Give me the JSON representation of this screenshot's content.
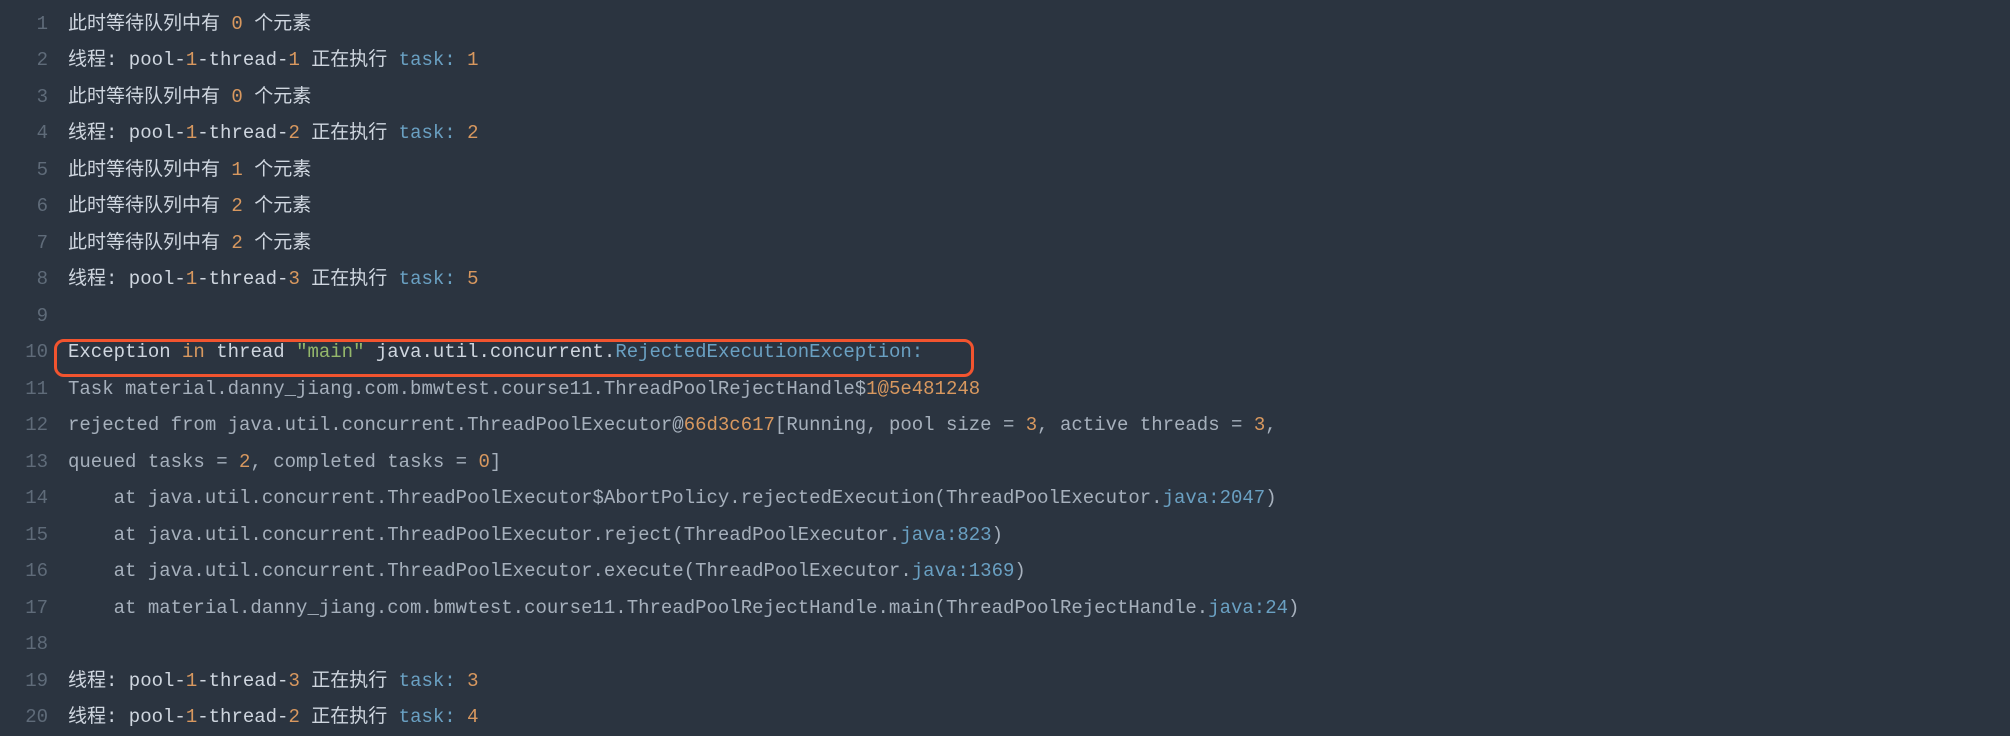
{
  "lines": [
    {
      "n": "1",
      "segs": [
        {
          "t": "此时等待队列中有 ",
          "c": "tok-cn"
        },
        {
          "t": "0",
          "c": "tok-num"
        },
        {
          "t": " 个元素",
          "c": "tok-cn"
        }
      ]
    },
    {
      "n": "2",
      "segs": [
        {
          "t": "线程: pool-",
          "c": "tok-cn"
        },
        {
          "t": "1",
          "c": "tok-num"
        },
        {
          "t": "-thread-",
          "c": "tok-cn"
        },
        {
          "t": "1",
          "c": "tok-num"
        },
        {
          "t": " 正在执行 ",
          "c": "tok-cn"
        },
        {
          "t": "task: ",
          "c": "tok-id"
        },
        {
          "t": "1",
          "c": "tok-num"
        }
      ]
    },
    {
      "n": "3",
      "segs": [
        {
          "t": "此时等待队列中有 ",
          "c": "tok-cn"
        },
        {
          "t": "0",
          "c": "tok-num"
        },
        {
          "t": " 个元素",
          "c": "tok-cn"
        }
      ]
    },
    {
      "n": "4",
      "segs": [
        {
          "t": "线程: pool-",
          "c": "tok-cn"
        },
        {
          "t": "1",
          "c": "tok-num"
        },
        {
          "t": "-thread-",
          "c": "tok-cn"
        },
        {
          "t": "2",
          "c": "tok-num"
        },
        {
          "t": " 正在执行 ",
          "c": "tok-cn"
        },
        {
          "t": "task: ",
          "c": "tok-id"
        },
        {
          "t": "2",
          "c": "tok-num"
        }
      ]
    },
    {
      "n": "5",
      "segs": [
        {
          "t": "此时等待队列中有 ",
          "c": "tok-cn"
        },
        {
          "t": "1",
          "c": "tok-num"
        },
        {
          "t": " 个元素",
          "c": "tok-cn"
        }
      ]
    },
    {
      "n": "6",
      "segs": [
        {
          "t": "此时等待队列中有 ",
          "c": "tok-cn"
        },
        {
          "t": "2",
          "c": "tok-num"
        },
        {
          "t": " 个元素",
          "c": "tok-cn"
        }
      ]
    },
    {
      "n": "7",
      "segs": [
        {
          "t": "此时等待队列中有 ",
          "c": "tok-cn"
        },
        {
          "t": "2",
          "c": "tok-num"
        },
        {
          "t": " 个元素",
          "c": "tok-cn"
        }
      ]
    },
    {
      "n": "8",
      "segs": [
        {
          "t": "线程: pool-",
          "c": "tok-cn"
        },
        {
          "t": "1",
          "c": "tok-num"
        },
        {
          "t": "-thread-",
          "c": "tok-cn"
        },
        {
          "t": "3",
          "c": "tok-num"
        },
        {
          "t": " 正在执行 ",
          "c": "tok-cn"
        },
        {
          "t": "task: ",
          "c": "tok-id"
        },
        {
          "t": "5",
          "c": "tok-num"
        }
      ]
    },
    {
      "n": "9",
      "segs": []
    },
    {
      "n": "10",
      "highlight": true,
      "hl_width": 920,
      "segs": [
        {
          "t": "Exception ",
          "c": "tok-default"
        },
        {
          "t": "in",
          "c": "tok-kw"
        },
        {
          "t": " thread ",
          "c": "tok-default"
        },
        {
          "t": "\"main\"",
          "c": "tok-str"
        },
        {
          "t": " java.util.concurrent.",
          "c": "tok-default"
        },
        {
          "t": "RejectedExecutionException:",
          "c": "tok-id"
        }
      ]
    },
    {
      "n": "11",
      "segs": [
        {
          "t": "Task material.danny_jiang.com.bmwtest.course11.ThreadPoolRejectHandle$",
          "c": "tok-gray"
        },
        {
          "t": "1@5e481248",
          "c": "tok-num"
        }
      ]
    },
    {
      "n": "12",
      "segs": [
        {
          "t": "rejected from java.util.concurrent.ThreadPoolExecutor@",
          "c": "tok-gray"
        },
        {
          "t": "66d3c617",
          "c": "tok-num"
        },
        {
          "t": "[Running, pool size = ",
          "c": "tok-gray"
        },
        {
          "t": "3",
          "c": "tok-num"
        },
        {
          "t": ", active threads = ",
          "c": "tok-gray"
        },
        {
          "t": "3",
          "c": "tok-num"
        },
        {
          "t": ",",
          "c": "tok-gray"
        }
      ]
    },
    {
      "n": "13",
      "segs": [
        {
          "t": "queued tasks = ",
          "c": "tok-gray"
        },
        {
          "t": "2",
          "c": "tok-num"
        },
        {
          "t": ", completed tasks = ",
          "c": "tok-gray"
        },
        {
          "t": "0",
          "c": "tok-num"
        },
        {
          "t": "]",
          "c": "tok-gray"
        }
      ]
    },
    {
      "n": "14",
      "segs": [
        {
          "t": "    at java.util.concurrent.ThreadPoolExecutor$AbortPolicy.rejectedExecution(ThreadPoolExecutor.",
          "c": "tok-gray"
        },
        {
          "t": "java:2047",
          "c": "tok-id"
        },
        {
          "t": ")",
          "c": "tok-gray"
        }
      ]
    },
    {
      "n": "15",
      "segs": [
        {
          "t": "    at java.util.concurrent.ThreadPoolExecutor.reject(ThreadPoolExecutor.",
          "c": "tok-gray"
        },
        {
          "t": "java:823",
          "c": "tok-id"
        },
        {
          "t": ")",
          "c": "tok-gray"
        }
      ]
    },
    {
      "n": "16",
      "segs": [
        {
          "t": "    at java.util.concurrent.ThreadPoolExecutor.execute(ThreadPoolExecutor.",
          "c": "tok-gray"
        },
        {
          "t": "java:1369",
          "c": "tok-id"
        },
        {
          "t": ")",
          "c": "tok-gray"
        }
      ]
    },
    {
      "n": "17",
      "segs": [
        {
          "t": "    at material.danny_jiang.com.bmwtest.course11.ThreadPoolRejectHandle.main(ThreadPoolRejectHandle.",
          "c": "tok-gray"
        },
        {
          "t": "java:24",
          "c": "tok-id"
        },
        {
          "t": ")",
          "c": "tok-gray"
        }
      ]
    },
    {
      "n": "18",
      "segs": []
    },
    {
      "n": "19",
      "segs": [
        {
          "t": "线程: pool-",
          "c": "tok-cn"
        },
        {
          "t": "1",
          "c": "tok-num"
        },
        {
          "t": "-thread-",
          "c": "tok-cn"
        },
        {
          "t": "3",
          "c": "tok-num"
        },
        {
          "t": " 正在执行 ",
          "c": "tok-cn"
        },
        {
          "t": "task: ",
          "c": "tok-id"
        },
        {
          "t": "3",
          "c": "tok-num"
        }
      ]
    },
    {
      "n": "20",
      "segs": [
        {
          "t": "线程: pool-",
          "c": "tok-cn"
        },
        {
          "t": "1",
          "c": "tok-num"
        },
        {
          "t": "-thread-",
          "c": "tok-cn"
        },
        {
          "t": "2",
          "c": "tok-num"
        },
        {
          "t": " 正在执行 ",
          "c": "tok-cn"
        },
        {
          "t": "task: ",
          "c": "tok-id"
        },
        {
          "t": "4",
          "c": "tok-num"
        }
      ]
    }
  ]
}
